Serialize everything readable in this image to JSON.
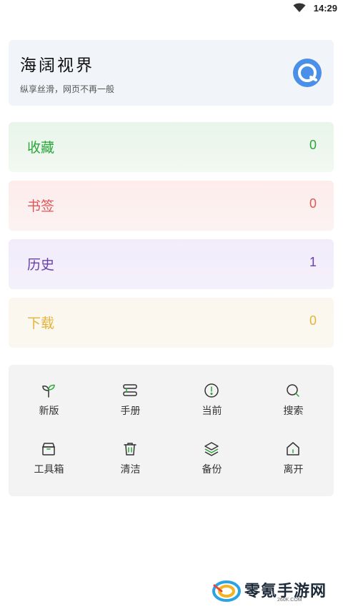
{
  "status_bar": {
    "time": "14:29",
    "wifi_icon": "wifi-icon"
  },
  "header": {
    "title": "海阔视界",
    "subtitle": "纵享丝滑，网页不再一般",
    "logo_icon": "app-logo-icon",
    "logo_color": "#4a8fe8"
  },
  "stats": [
    {
      "label": "收藏",
      "value": "0",
      "color": "#2aa63a"
    },
    {
      "label": "书签",
      "value": "0",
      "color": "#e05555"
    },
    {
      "label": "历史",
      "value": "1",
      "color": "#6a3fb0"
    },
    {
      "label": "下载",
      "value": "0",
      "color": "#e6b23a"
    }
  ],
  "tools": [
    {
      "label": "新版",
      "icon": "sprout-icon"
    },
    {
      "label": "手册",
      "icon": "manual-icon"
    },
    {
      "label": "当前",
      "icon": "info-circle-icon"
    },
    {
      "label": "搜索",
      "icon": "search-icon"
    },
    {
      "label": "工具箱",
      "icon": "toolbox-icon"
    },
    {
      "label": "清洁",
      "icon": "trash-icon"
    },
    {
      "label": "备份",
      "icon": "layers-icon"
    },
    {
      "label": "离开",
      "icon": "home-icon"
    }
  ],
  "accent_green": "#2aa63a",
  "watermark": {
    "text": "零氪手游网",
    "url": "260K.COM"
  }
}
